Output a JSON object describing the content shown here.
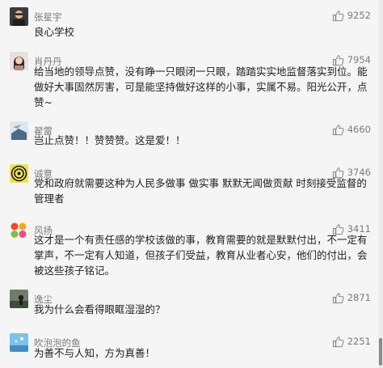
{
  "comments": [
    {
      "name": "张星宇",
      "likes": "9252",
      "text": "良心学校"
    },
    {
      "name": "肖丹丹",
      "likes": "7954",
      "text": "给当地的领导点赞，没有睁一只眼闭一只眼，踏踏实实地监督落实到位。能做好大事固然厉害，可是能坚持做好这样的小事，实属不易。阳光公开，点赞~"
    },
    {
      "name": "翟雷",
      "likes": "4660",
      "text": "岂止点赞！！赞赞赞。这是爱！！"
    },
    {
      "name": "诚意",
      "likes": "3746",
      "text": "党和政府就需要这种为人民多做事 做实事 默默无闻做贡献 时刻接受监督的管理者"
    },
    {
      "name": "风扬",
      "likes": "3411",
      "text": "这才是一个有责任感的学校该做的事，教育需要的就是默默付出，不一定有掌声，不一定有人知道，但孩子们受益，教育从业者心安，他们的付出，会被这些孩子铭记。"
    },
    {
      "name": "逸尘",
      "likes": "2871",
      "text": "我为什么会看得眼眶湿湿的？"
    },
    {
      "name": "吹泡泡的鱼",
      "likes": "2251",
      "text": "为善不与人知，方为真善！"
    }
  ],
  "icons": {
    "like": "thumbs-up-icon"
  },
  "colors": {
    "meta_text": "#7b7b7b",
    "body_text": "#222222",
    "background": "#f5f5f5"
  }
}
